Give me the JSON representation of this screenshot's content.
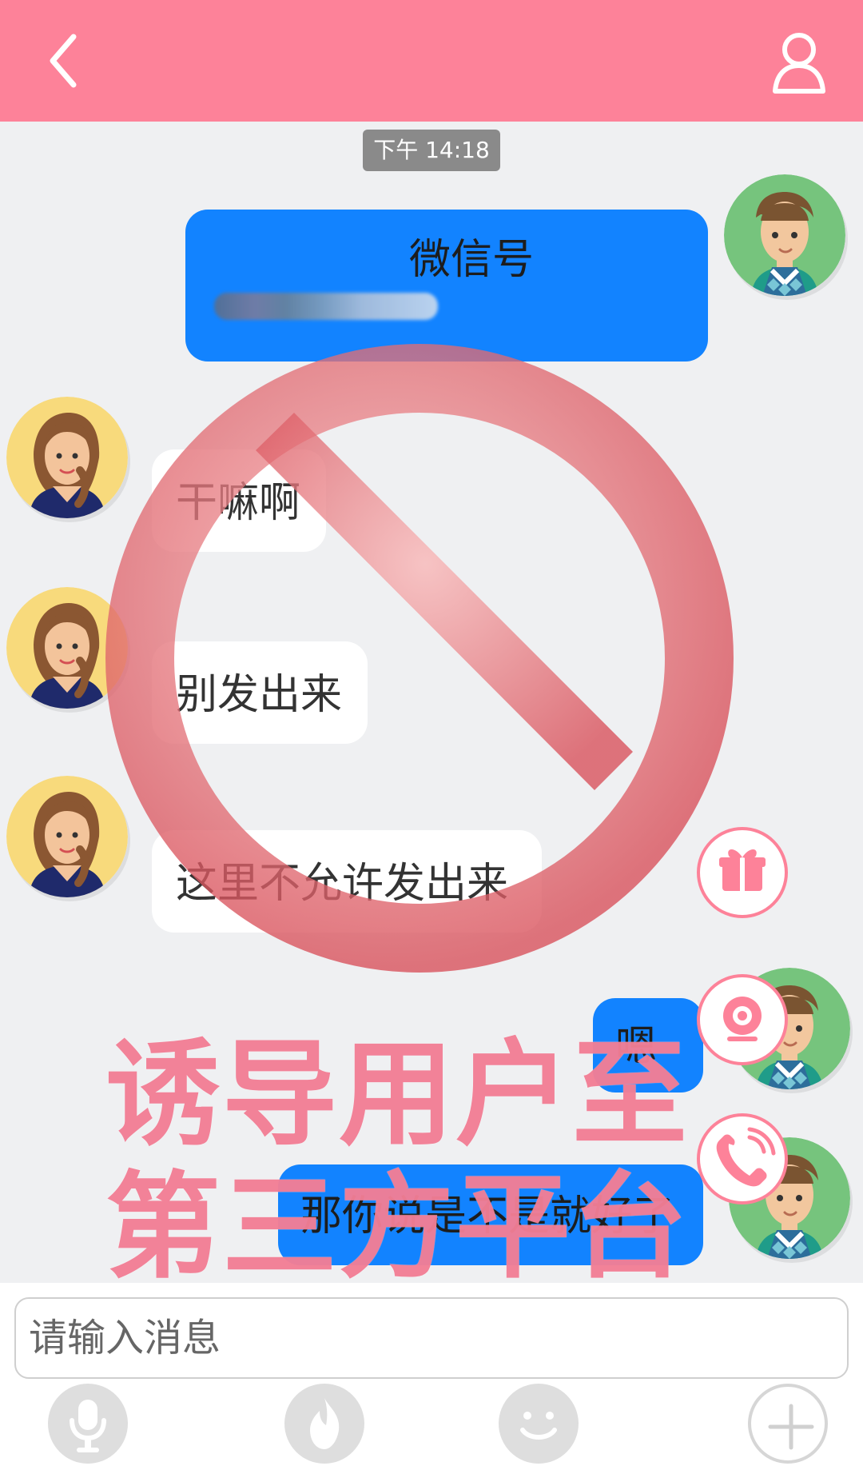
{
  "header": {
    "back_icon": "back-arrow-icon",
    "profile_icon": "user-profile-icon"
  },
  "chat": {
    "timestamp": "下午 14:18",
    "messages": [
      {
        "side": "right",
        "text": "微信号",
        "subtext": "*******6222"
      },
      {
        "side": "left",
        "text": "干嘛啊"
      },
      {
        "side": "left",
        "text": "别发出来"
      },
      {
        "side": "left",
        "text": "这里不允许发出来"
      },
      {
        "side": "right",
        "text": "嗯"
      },
      {
        "side": "right",
        "text": "那你说是不是就好了"
      }
    ]
  },
  "floating_actions": [
    {
      "icon": "gift-icon"
    },
    {
      "icon": "camera-icon"
    },
    {
      "icon": "phone-icon"
    }
  ],
  "overlay": {
    "line1": "诱导用户至",
    "line2": "第三方平台"
  },
  "composer": {
    "placeholder": "请输入消息"
  },
  "bottom_actions": [
    {
      "icon": "microphone-icon"
    },
    {
      "icon": "fire-icon"
    },
    {
      "icon": "emoji-icon"
    },
    {
      "icon": "plus-icon"
    }
  ]
}
